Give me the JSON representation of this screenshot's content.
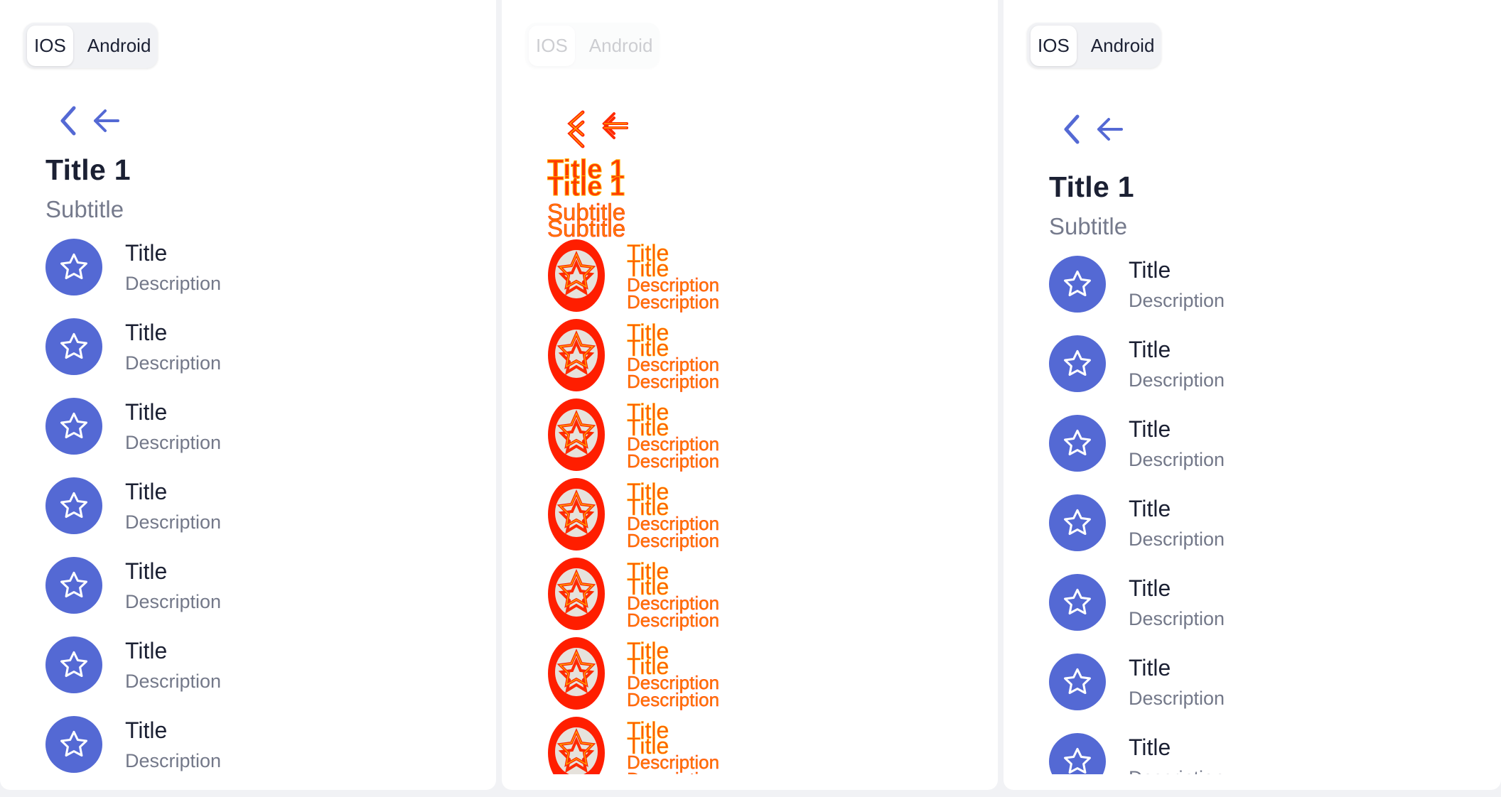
{
  "toggle": {
    "ios_label": "IOS",
    "android_label": "Android"
  },
  "header": {
    "title": "Title 1",
    "subtitle": "Subtitle"
  },
  "panel_a": {
    "items": [
      {
        "title": "Title",
        "description": "Description"
      },
      {
        "title": "Title",
        "description": "Description"
      },
      {
        "title": "Title",
        "description": "Description"
      },
      {
        "title": "Title",
        "description": "Description"
      },
      {
        "title": "Title",
        "description": "Description"
      },
      {
        "title": "Title",
        "description": "Description"
      },
      {
        "title": "Title",
        "description": "Description"
      }
    ]
  },
  "panel_c": {
    "items": [
      {
        "title": "Title",
        "description": "Description"
      },
      {
        "title": "Title",
        "description": "Description"
      },
      {
        "title": "Title",
        "description": "Description"
      },
      {
        "title": "Title",
        "description": "Description"
      },
      {
        "title": "Title",
        "description": "Description"
      },
      {
        "title": "Title",
        "description": "Description"
      },
      {
        "title": "Title",
        "description": "Description"
      }
    ]
  },
  "icons": {
    "back_chevron": "chevron-left-icon",
    "back_arrow": "arrow-left-icon",
    "list_item": "star-icon"
  },
  "colors": {
    "accent": "#5469d4",
    "text_primary": "#1b2033",
    "text_secondary": "#757a8c",
    "overlay_red": "#ff2a00",
    "overlay_yellow": "#ffb000"
  }
}
